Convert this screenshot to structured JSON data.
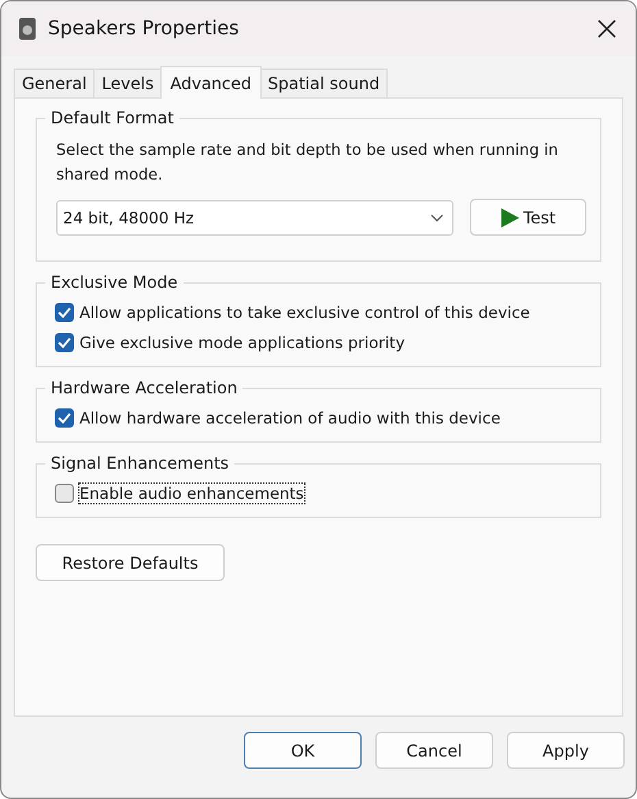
{
  "window": {
    "title": "Speakers Properties"
  },
  "tabs": [
    {
      "label": "General",
      "selected": false
    },
    {
      "label": "Levels",
      "selected": false
    },
    {
      "label": "Advanced",
      "selected": true
    },
    {
      "label": "Spatial sound",
      "selected": false
    }
  ],
  "groups": [
    {
      "title": "Default Format",
      "description": "Select the sample rate and bit depth to be used when running in shared mode.",
      "format": {
        "value": "24 bit, 48000 Hz"
      },
      "test_button": "Test"
    },
    {
      "title": "Exclusive Mode",
      "checkboxes": [
        {
          "label": "Allow applications to take exclusive control of this device",
          "checked": true,
          "focused": false
        },
        {
          "label": "Give exclusive mode applications priority",
          "checked": true,
          "focused": false
        }
      ]
    },
    {
      "title": "Hardware Acceleration",
      "checkboxes": [
        {
          "label": "Allow hardware acceleration of audio with this device",
          "checked": true,
          "focused": false
        }
      ]
    },
    {
      "title": "Signal Enhancements",
      "checkboxes": [
        {
          "label": "Enable audio enhancements",
          "checked": false,
          "focused": true
        }
      ]
    }
  ],
  "restore_button": "Restore Defaults",
  "buttons": [
    {
      "label": "OK",
      "default": true
    },
    {
      "label": "Cancel",
      "default": false
    },
    {
      "label": "Apply",
      "default": false
    }
  ]
}
